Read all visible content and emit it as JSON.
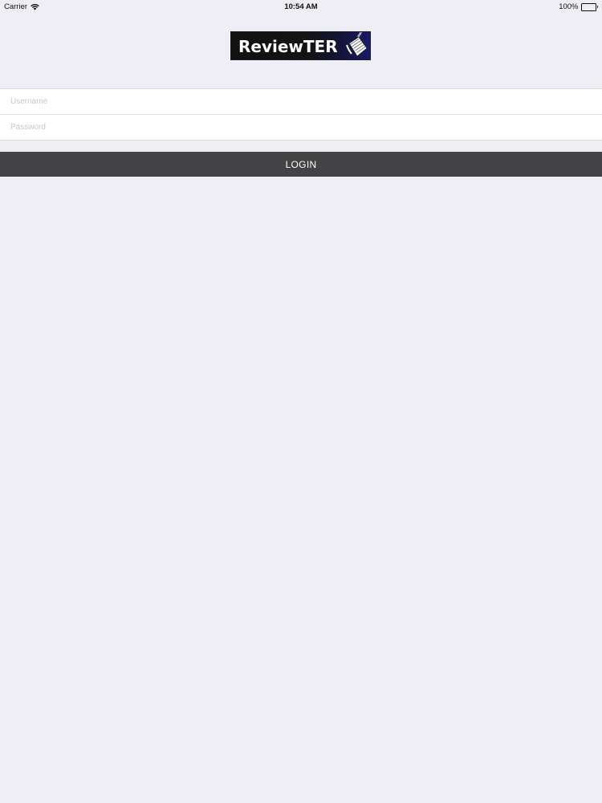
{
  "status_bar": {
    "carrier": "Carrier",
    "wifi_icon": "wifi-icon",
    "time": "10:54 AM",
    "battery_percent": "100%",
    "battery_icon": "battery-icon",
    "battery_level": 1.0
  },
  "logo": {
    "text": "ReviewTER"
  },
  "login_form": {
    "username": {
      "value": "",
      "placeholder": "Username"
    },
    "password": {
      "value": "",
      "placeholder": "Password"
    },
    "login_label": "LOGIN"
  },
  "colors": {
    "background": "#efeef4",
    "button": "#434244",
    "button_text": "#ffffff",
    "placeholder": "#c7c7cd"
  }
}
